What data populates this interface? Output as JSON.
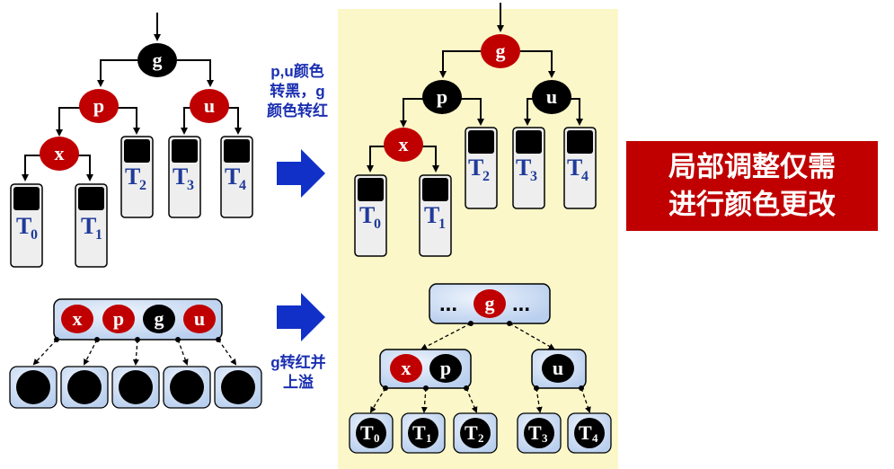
{
  "nodes": {
    "g": "g",
    "p": "p",
    "u": "u",
    "x": "x",
    "dots": "..."
  },
  "subtrees": {
    "T": "T",
    "s0": "0",
    "s1": "1",
    "s2": "2",
    "s3": "3",
    "s4": "4"
  },
  "captions": {
    "recolor_line1": "p,u颜色",
    "recolor_line2": "转黑，g",
    "recolor_line3": "颜色转红",
    "overflow_line1": "g转红并",
    "overflow_line2": "上溢"
  },
  "callout": {
    "line1": "局部调整仅需",
    "line2": "进行颜色更改"
  },
  "colors": {
    "red_node": "#c00000",
    "black_node": "#000000",
    "highlight_panel": "#fbf7c8",
    "bnode_fill": "#c9dcf5",
    "arrow_blue": "#1030c8",
    "callout_bg": "#c00000",
    "caption_text": "#1a2fb0"
  }
}
